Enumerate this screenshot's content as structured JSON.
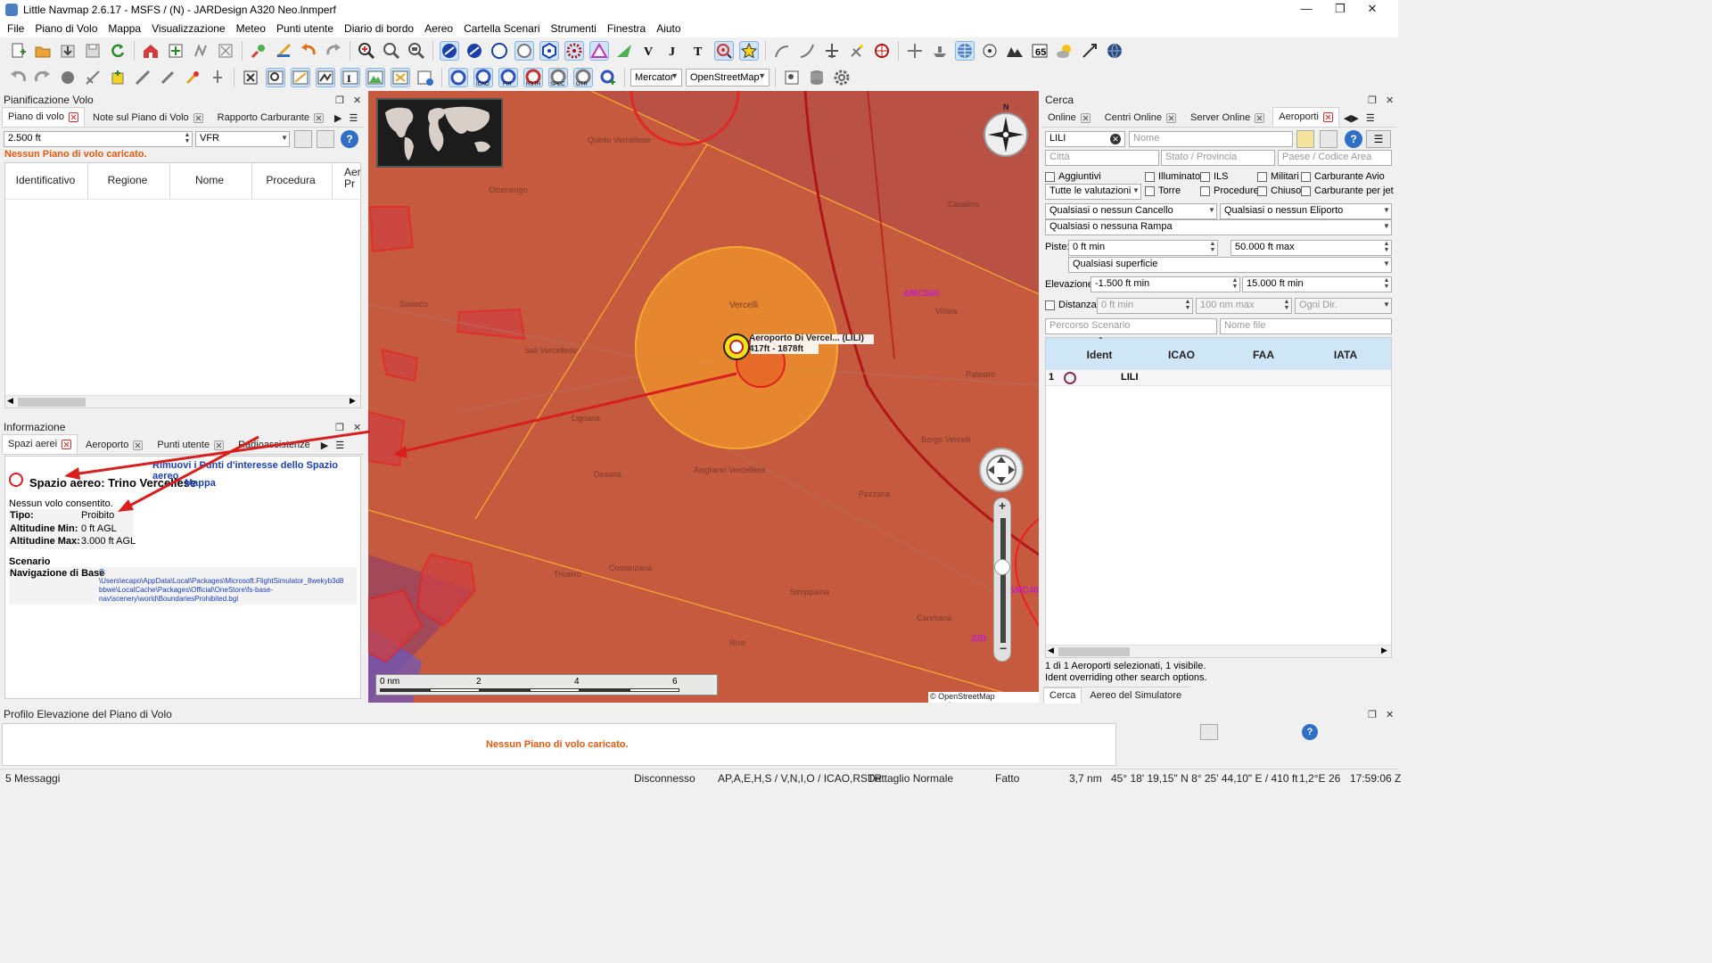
{
  "window": {
    "title": "Little Navmap 2.6.17 - MSFS / (N) - JARDesign A320 Neo.lnmperf",
    "controls": [
      "minimize-icon",
      "restore-icon",
      "close-icon"
    ]
  },
  "menu": [
    "File",
    "Piano di Volo",
    "Mappa",
    "Visualizzazione",
    "Meteo",
    "Punti utente",
    "Diario di bordo",
    "Aereo",
    "Cartella Scenari",
    "Strumenti",
    "Finestra",
    "Aiuto"
  ],
  "toolbar2": {
    "projection": "Mercator",
    "theme": "OpenStreetMap"
  },
  "flightplan_panel": {
    "header": "Pianificazione Volo",
    "tabs": [
      "Piano di volo",
      "Note sul Piano di Volo",
      "Rapporto Carburante"
    ],
    "altitude": "2.500 ft",
    "type": "VFR",
    "warning": "Nessun Piano di volo caricato.",
    "columns": [
      "Identificativo",
      "Regione",
      "Nome",
      "Procedura",
      "Aer\nPr"
    ]
  },
  "info_panel": {
    "header": "Informazione",
    "tabs": [
      "Spazi aerei",
      "Aeroporto",
      "Punti utente",
      "Radioassistenze"
    ],
    "remove_link": "Rimuovi i Punti d'interesse dello Spazio aereo",
    "airspace_title": "Spazio aereo: Trino Vercellese",
    "map_link": "Mappa",
    "note": "Nessun volo consentito.",
    "rows": [
      {
        "label": "Tipo:",
        "value": "Proibito"
      },
      {
        "label": "Altitudine Min:",
        "value": "0 ft AGL"
      },
      {
        "label": "Altitudine Max:",
        "value": "3.000 ft AGL"
      }
    ],
    "scenery_title": "Scenario",
    "scenery_label": "Navigazione di Base",
    "scenery_path": [
      "C:",
      "\\Users\\ecapo\\AppData\\Local\\Packages\\Microsoft.FlightSimulator_8wekyb3d8",
      "bbwe\\LocalCache\\Packages\\Official\\OneStore\\fs-base-",
      "nav\\scenery\\world\\BoundariesProhibited.bgl"
    ]
  },
  "map": {
    "airport_label": "Aeroporto Di Vercel... (LILI)",
    "airport_sub": "417ft - 1878ft",
    "compass_n": "N",
    "scale": [
      "0 nm",
      "2",
      "4",
      "6"
    ],
    "copyright": "© OpenStreetMap contributors",
    "mark1": "ΔMCS60",
    "mark2": "ΔMC40",
    "mark3": "ΔIB",
    "places": [
      {
        "name": "Quinto Vercellese"
      },
      {
        "name": "Olcenengo"
      },
      {
        "name": "Salasco"
      },
      {
        "name": "Sali Vercellese"
      },
      {
        "name": "Vercelli"
      },
      {
        "name": "Lignana"
      },
      {
        "name": "Desana"
      },
      {
        "name": "Asigliano Vercellese"
      },
      {
        "name": "Costanzana"
      },
      {
        "name": "Tricerro"
      },
      {
        "name": "Stroppiana"
      },
      {
        "name": "Pezzana"
      },
      {
        "name": "Caresana"
      },
      {
        "name": "Rive"
      },
      {
        "name": "Casalino"
      },
      {
        "name": "Villata"
      },
      {
        "name": "Palestro"
      },
      {
        "name": "Borgo Vercelli"
      }
    ]
  },
  "search_panel": {
    "header": "Cerca",
    "tabs": [
      "Online",
      "Centri Online",
      "Server Online",
      "Aeroporti"
    ],
    "ident_value": "LILI",
    "name_ph": "Nome",
    "city_ph": "Città",
    "state_ph": "Stato / Provincia",
    "country_ph": "Paese / Codice Area",
    "checks": [
      "Aggiuntivi",
      "Illuminato",
      "ILS",
      "Militari",
      "Carburante Avio",
      "Torre",
      "Procedure",
      "Chiuso",
      "Carburante per jet"
    ],
    "rating": "Tutte le valutazioni",
    "gate": "Qualsiasi o nessun Cancello",
    "helipad": "Qualsiasi o nessun Eliporto",
    "ramp": "Qualsiasi o nessuna Rampa",
    "runway_label": "Piste:",
    "runway_min": "0 ft min",
    "runway_max": "50.000 ft max",
    "surface": "Qualsiasi superficie",
    "elev_label": "Elevazione:",
    "elev_min": "-1.500 ft min",
    "elev_max": "15.000 ft min",
    "dist_label": "Distanza:",
    "dist_min": "0 ft min",
    "dist_max": "100 nm max",
    "dir": "Ogni Dir.",
    "path_ph": "Percorso Scenario",
    "file_ph": "Nome file",
    "columns": [
      "Ident",
      "ICAO",
      "FAA",
      "IATA"
    ],
    "rows": [
      {
        "n": "1",
        "ident": "LILI"
      }
    ],
    "status1": "1 di 1 Aeroporti selezionati, 1 visibile.",
    "status2": "Ident overriding other search options.",
    "bottom_tabs": [
      "Cerca",
      "Aereo del Simulatore"
    ]
  },
  "profile_panel": {
    "header": "Profilo Elevazione del Piano di Volo",
    "message": "Nessun Piano di volo caricato."
  },
  "status": {
    "messages": "5 Messaggi",
    "conn": "Disconnesso",
    "layers": "AP,A,E,H,S / V,N,I,O / ICAO,RSTR",
    "detail": "Dettaglio Normale",
    "done": "Fatto",
    "dist": "3,7 nm",
    "coords": "45° 18' 19,15\" N 8° 25' 44,10\" E / 410 ft",
    "mag": "1,2°E",
    "zoom": "26",
    "time": "17:59:06 Z"
  },
  "colors": {
    "airspace": "#c85a3c",
    "danger": "#e8281e",
    "orange": "#f5a020"
  }
}
